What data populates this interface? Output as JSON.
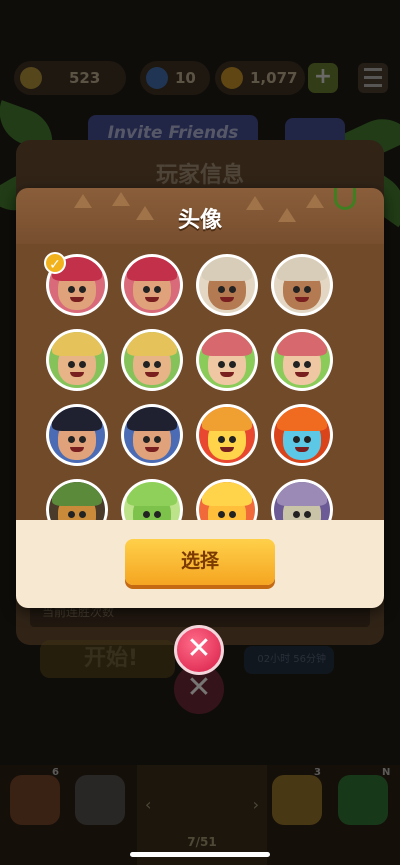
{
  "topbar": {
    "trophies": "523",
    "energy": "10",
    "coins": "1,077",
    "plus_label": "+"
  },
  "background": {
    "invite_label": "Invite Friends",
    "panel_title": "玩家信息",
    "streak_label": "当前连胜次数",
    "start_label": "开始!",
    "timer_text": "02小时 56分钟"
  },
  "modal": {
    "title": "头像",
    "select_label": "选择",
    "avatars": [
      {
        "name": "girl-red-bandana-smile",
        "hat": "#c2304a",
        "skin": "#e0a27a",
        "bg": "#d96a7a",
        "selected": true
      },
      {
        "name": "girl-red-bandana-starstruck",
        "hat": "#c2304a",
        "skin": "#e0a27a",
        "bg": "#d96a7a",
        "selected": false
      },
      {
        "name": "grandma-curly-crying",
        "hat": "#d8cdb8",
        "skin": "#b47a52",
        "bg": "#e3d7c3",
        "selected": false
      },
      {
        "name": "grandma-curly-heart-eyes",
        "hat": "#d8cdb8",
        "skin": "#b47a52",
        "bg": "#e3d7c3",
        "selected": false
      },
      {
        "name": "blond-man-smile",
        "hat": "#e5c25a",
        "skin": "#e6b486",
        "bg": "#86c25a",
        "selected": false
      },
      {
        "name": "blond-man-angry",
        "hat": "#e5c25a",
        "skin": "#e6b486",
        "bg": "#86c25a",
        "selected": false
      },
      {
        "name": "old-lady-glasses-smile",
        "hat": "#d7696e",
        "skin": "#f0c7a3",
        "bg": "#8bcb5a",
        "selected": false
      },
      {
        "name": "old-lady-glasses-wink",
        "hat": "#d7696e",
        "skin": "#f0c7a3",
        "bg": "#8bcb5a",
        "selected": false
      },
      {
        "name": "pirate-eyepatch-smile",
        "hat": "#1f2030",
        "skin": "#e0a27a",
        "bg": "#4b6cb5",
        "selected": false
      },
      {
        "name": "pirate-eyepatch-grin",
        "hat": "#1f2030",
        "skin": "#e0a27a",
        "bg": "#4b6cb5",
        "selected": false
      },
      {
        "name": "fire-flame",
        "hat": "#f0a030",
        "skin": "#ffd34a",
        "bg": "#e84830",
        "selected": false
      },
      {
        "name": "orange-robot-eye",
        "hat": "#f06a1f",
        "skin": "#5dc8e6",
        "bg": "#d9441a",
        "selected": false
      },
      {
        "name": "owl-mask",
        "hat": "#5a8a3a",
        "skin": "#c98a3a",
        "bg": "#4a3a2a",
        "selected": false
      },
      {
        "name": "green-frog",
        "hat": "#8fd05a",
        "skin": "#7dc24a",
        "bg": "#bde38a",
        "selected": false
      },
      {
        "name": "yellow-chick",
        "hat": "#ffd34a",
        "skin": "#ffbf3a",
        "bg": "#f06a3a",
        "selected": false
      },
      {
        "name": "knight-helmet",
        "hat": "#9a8ab5",
        "skin": "#c9c3a8",
        "bg": "#6b5a95",
        "selected": false
      }
    ]
  },
  "bottom_nav": {
    "badge_left": "6",
    "badge_right1": "3",
    "badge_right2": "N",
    "level": "7/51"
  },
  "close_label": "✕",
  "check_label": "✓"
}
